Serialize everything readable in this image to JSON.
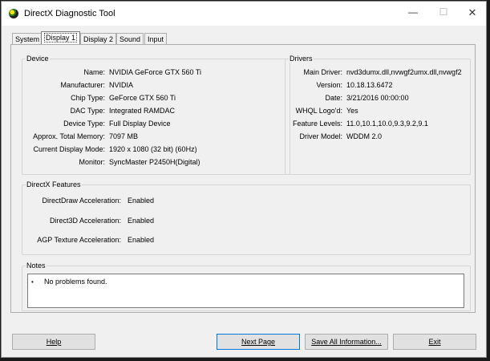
{
  "window": {
    "title": "DirectX Diagnostic Tool",
    "minimize": "—",
    "maximize": "☐",
    "close": "✕"
  },
  "tabs": [
    "System",
    "Display 1",
    "Display 2",
    "Sound",
    "Input"
  ],
  "device": {
    "title": "Device",
    "rows": [
      {
        "label": "Name:",
        "value": "NVIDIA GeForce GTX 560 Ti"
      },
      {
        "label": "Manufacturer:",
        "value": "NVIDIA"
      },
      {
        "label": "Chip Type:",
        "value": "GeForce GTX 560 Ti"
      },
      {
        "label": "DAC Type:",
        "value": "Integrated RAMDAC"
      },
      {
        "label": "Device Type:",
        "value": "Full Display Device"
      },
      {
        "label": "Approx. Total Memory:",
        "value": "7097 MB"
      },
      {
        "label": "Current Display Mode:",
        "value": "1920 x 1080 (32 bit) (60Hz)"
      },
      {
        "label": "Monitor:",
        "value": "SyncMaster P2450H(Digital)"
      }
    ]
  },
  "drivers": {
    "title": "Drivers",
    "rows": [
      {
        "label": "Main Driver:",
        "value": "nvd3dumx.dll,nvwgf2umx.dll,nvwgf2"
      },
      {
        "label": "Version:",
        "value": "10.18.13.6472"
      },
      {
        "label": "Date:",
        "value": "3/21/2016 00:00:00"
      },
      {
        "label": "WHQL Logo'd:",
        "value": "Yes"
      },
      {
        "label": "Feature Levels:",
        "value": "11.0,10.1,10.0,9.3,9.2,9.1"
      },
      {
        "label": "Driver Model:",
        "value": "WDDM 2.0"
      }
    ]
  },
  "features": {
    "title": "DirectX Features",
    "rows": [
      {
        "label": "DirectDraw Acceleration:",
        "value": "Enabled"
      },
      {
        "label": "Direct3D Acceleration:",
        "value": "Enabled"
      },
      {
        "label": "AGP Texture Acceleration:",
        "value": "Enabled"
      }
    ]
  },
  "notes": {
    "title": "Notes",
    "bullet": "•",
    "items": [
      "No problems found."
    ]
  },
  "buttons": {
    "help": "Help",
    "next": "Next Page",
    "save": "Save All Information...",
    "exit": "Exit"
  }
}
